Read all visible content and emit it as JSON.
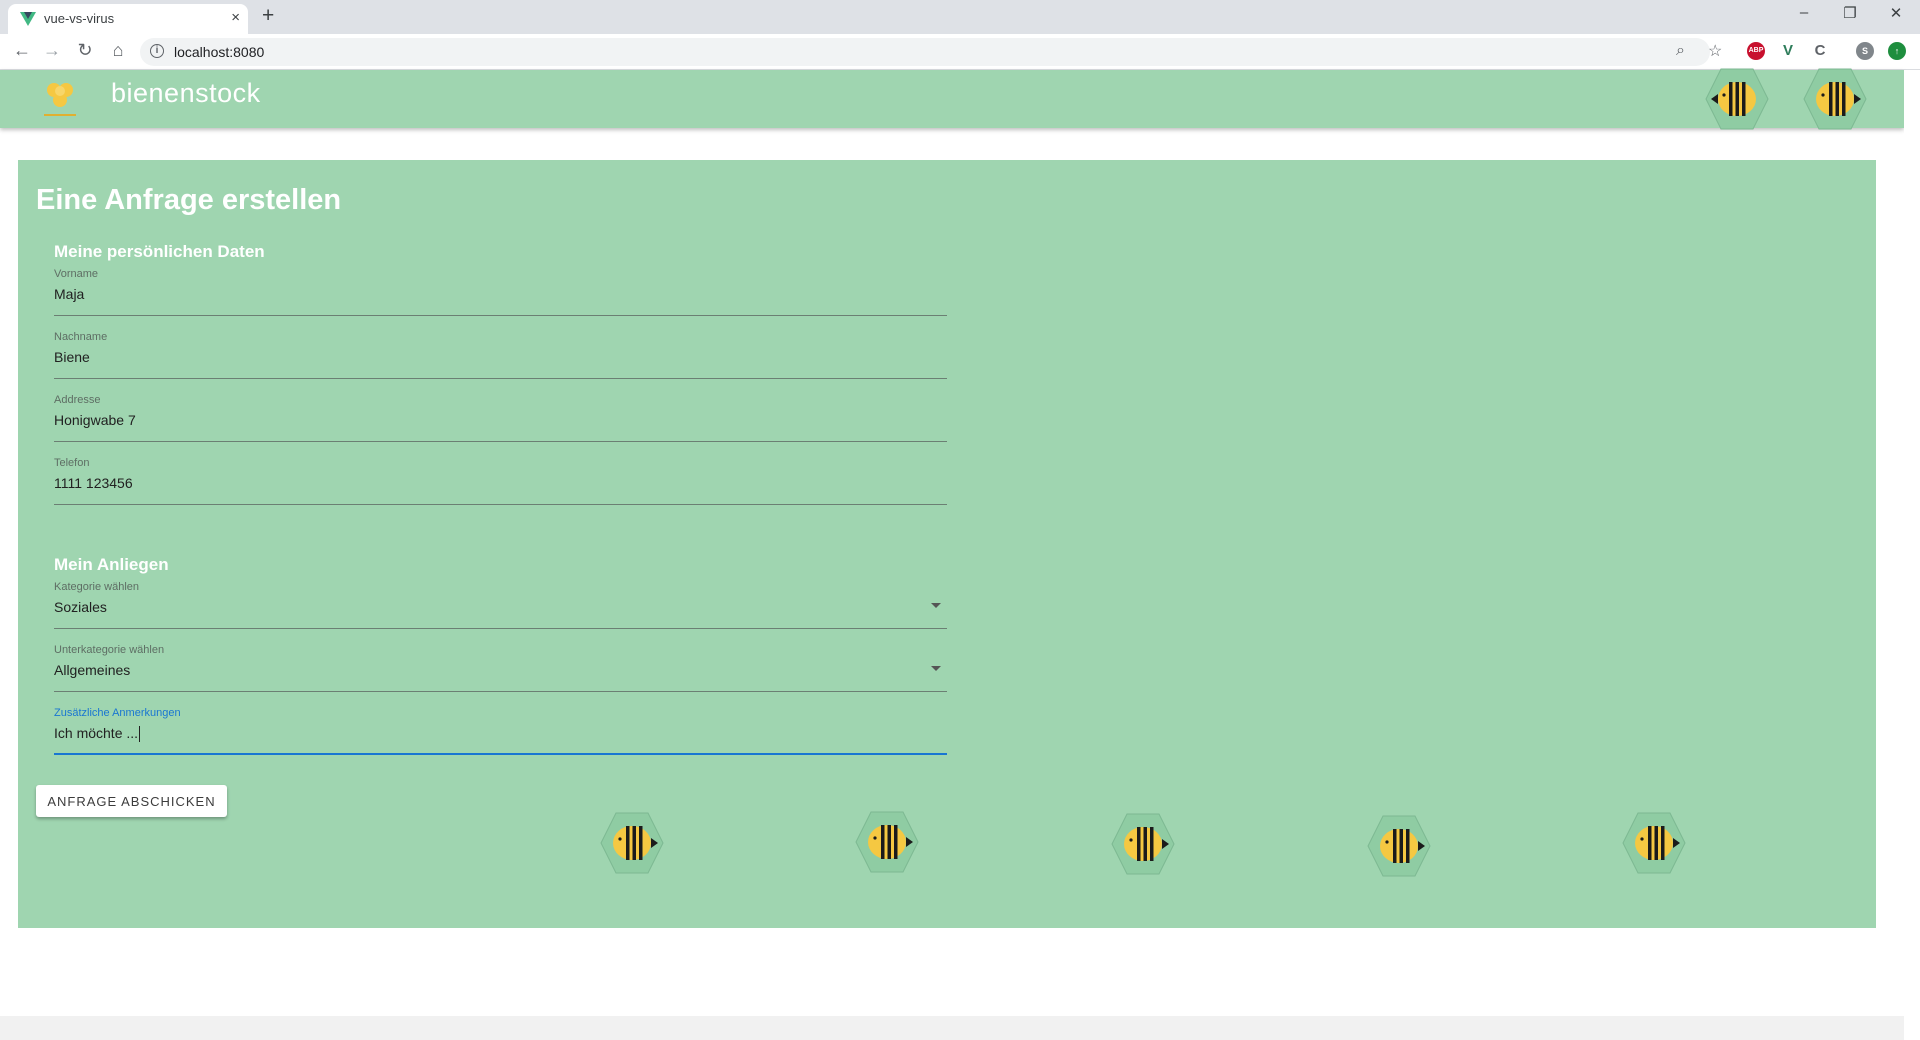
{
  "browser": {
    "tab_title": "vue-vs-virus",
    "tab_close": "×",
    "new_tab": "+",
    "url": "localhost:8080",
    "window_controls": {
      "minimize": "–",
      "restore": "❐",
      "close": "✕"
    },
    "profile_initial": "S",
    "extensions": [
      {
        "name": "adblock-icon",
        "label": "ABP",
        "color": "#c8102e"
      },
      {
        "name": "vue-devtools-icon",
        "label": "V",
        "color": "#2e7d5b"
      },
      {
        "name": "extension-c-icon",
        "label": "C",
        "color": "#5f6368"
      },
      {
        "name": "update-icon",
        "label": "↑",
        "color": "#1e8e3e"
      }
    ]
  },
  "app": {
    "brand": "bienenstock",
    "page_title": "Eine Anfrage erstellen",
    "personal_section": "Meine persönlichen Daten",
    "fields": {
      "firstname": {
        "label": "Vorname",
        "value": "Maja"
      },
      "lastname": {
        "label": "Nachname",
        "value": "Biene"
      },
      "address": {
        "label": "Addresse",
        "value": "Honigwabe 7"
      },
      "phone": {
        "label": "Telefon",
        "value": "1111 123456"
      }
    },
    "request_section": "Mein Anliegen",
    "selects": {
      "category": {
        "label": "Kategorie wählen",
        "value": "Soziales"
      },
      "subcategory": {
        "label": "Unterkategorie wählen",
        "value": "Allgemeines"
      }
    },
    "notes": {
      "label": "Zusätzliche Anmerkungen",
      "value": "Ich möchte ..."
    },
    "submit_label": "ANFRAGE ABSCHICKEN"
  },
  "colors": {
    "accent": "#9fd5b0",
    "focus": "#1976d2",
    "bee_yellow": "#f5c842"
  }
}
